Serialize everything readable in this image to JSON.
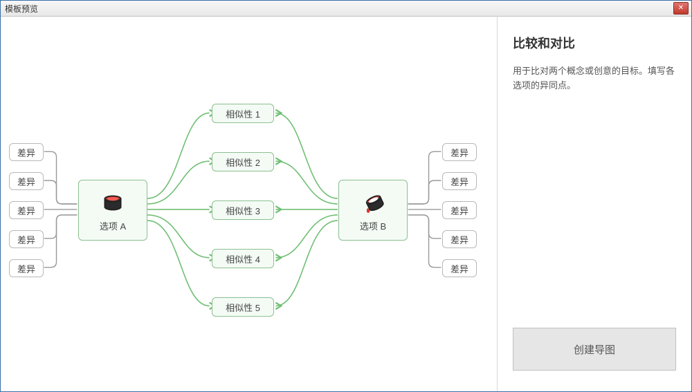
{
  "window": {
    "title": "模板预览"
  },
  "side": {
    "heading": "比较和对比",
    "description": "用于比对两个概念或创意的目标。填写各选项的异同点。",
    "create_button": "创建导图"
  },
  "diagram": {
    "option_a": {
      "label": "选项 A"
    },
    "option_b": {
      "label": "选项 B"
    },
    "diff_a": [
      "差异",
      "差异",
      "差异",
      "差异",
      "差异"
    ],
    "diff_b": [
      "差异",
      "差异",
      "差异",
      "差异",
      "差异"
    ],
    "similar": [
      "相似性 1",
      "相似性 2",
      "相似性 3",
      "相似性 4",
      "相似性 5"
    ]
  }
}
